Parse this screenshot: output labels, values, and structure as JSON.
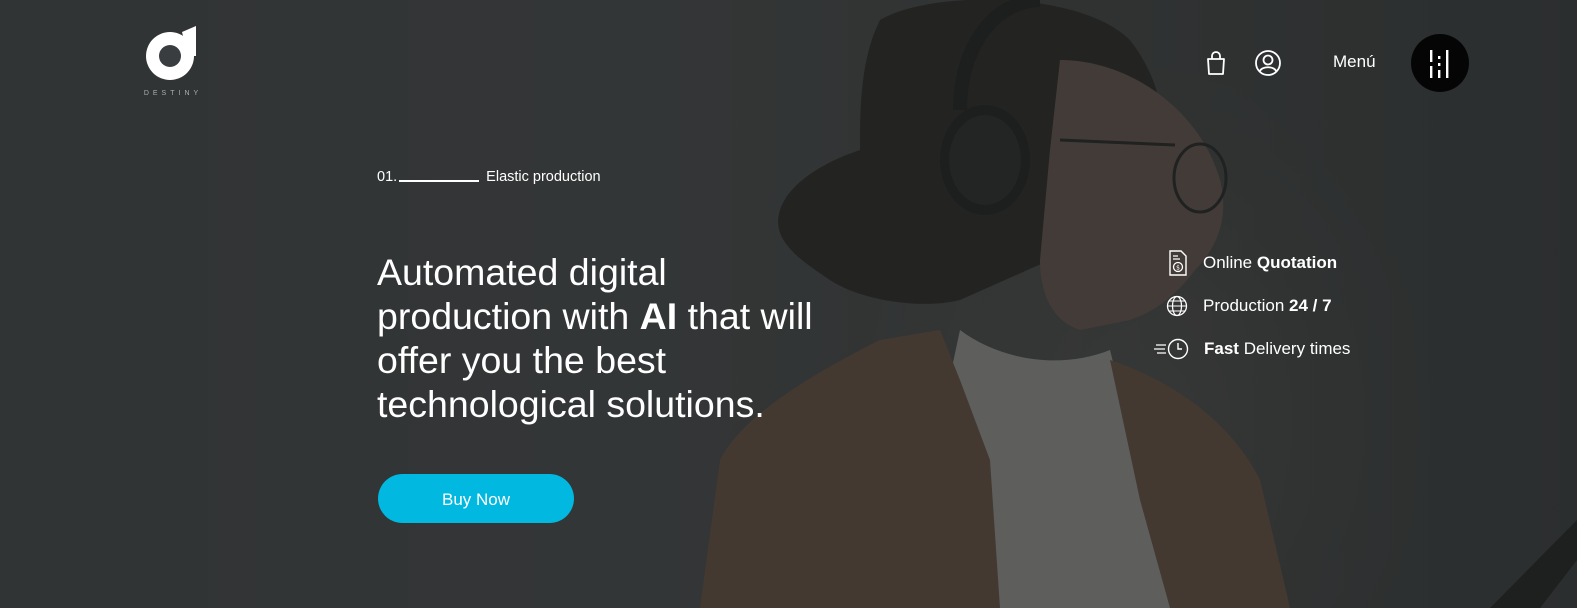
{
  "brand": {
    "logo_text": "DESTINY"
  },
  "nav": {
    "cart_icon": "shopping-bag-icon",
    "user_icon": "user-circle-icon",
    "menu_label": "Menú",
    "menu_icon": "menu-bars-icon"
  },
  "hero": {
    "eyebrow_number": "01.",
    "eyebrow_text": "Elastic production",
    "headline_part1": "Automated digital production with ",
    "headline_bold": "AI",
    "headline_part2": " that will offer you the best technological solutions.",
    "cta_label": "Buy Now"
  },
  "features": [
    {
      "icon": "quotation-document-icon",
      "text_regular": "Online ",
      "text_bold": "Quotation"
    },
    {
      "icon": "globe-icon",
      "text_regular": "Production ",
      "text_bold": "24 / 7"
    },
    {
      "icon": "fast-clock-icon",
      "text_bold": "Fast",
      "text_regular": " Delivery times"
    }
  ],
  "colors": {
    "accent": "#00b8e0",
    "menu_button": "#050505",
    "overlay": "#3a3d3f"
  }
}
